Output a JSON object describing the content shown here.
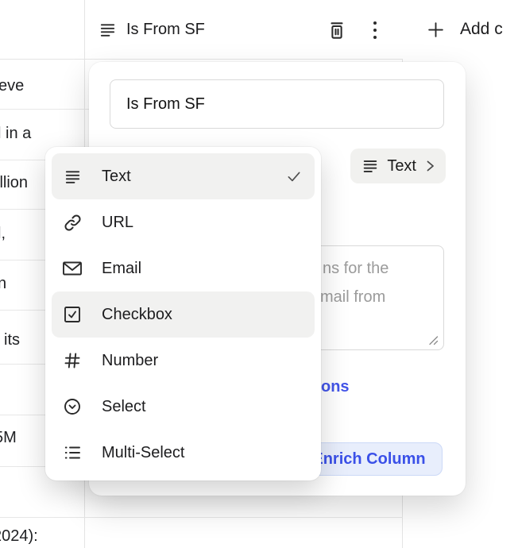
{
  "header": {
    "column_title": "Is From SF",
    "column_type_icon": "text-lines-icon",
    "trash_icon": "trash-icon",
    "kebab_icon": "kebab-menu-icon",
    "add_column_label": "Add c"
  },
  "popup": {
    "name_value": "Is From SF",
    "type_button": {
      "label": "Text",
      "icon": "text-lines-icon",
      "chevron": "chevron-right-icon"
    },
    "description_placeholder_fragments": {
      "line1": "ns for the",
      "line2": "mail from"
    },
    "link_fragment": "ons",
    "enrich_button_label": "Enrich Column"
  },
  "menu": {
    "items": [
      {
        "label": "Text",
        "icon": "text-lines-icon",
        "selected": true,
        "highlighted": true
      },
      {
        "label": "URL",
        "icon": "link-icon",
        "selected": false,
        "highlighted": false
      },
      {
        "label": "Email",
        "icon": "envelope-icon",
        "selected": false,
        "highlighted": false
      },
      {
        "label": "Checkbox",
        "icon": "checkbox-icon",
        "selected": false,
        "highlighted": true
      },
      {
        "label": "Number",
        "icon": "hash-icon",
        "selected": false,
        "highlighted": false
      },
      {
        "label": "Select",
        "icon": "circle-chevron-icon",
        "selected": false,
        "highlighted": false
      },
      {
        "label": "Multi-Select",
        "icon": "multi-list-icon",
        "selected": false,
        "highlighted": false
      }
    ]
  },
  "background": {
    "rows": [
      {
        "text": "eve"
      },
      {
        "text": "l in a"
      },
      {
        "text": "illion"
      },
      {
        "text": "l,"
      },
      {
        "text": "n"
      },
      {
        "text": "l its"
      },
      {
        "text": "5M"
      },
      {
        "text": "2024):"
      }
    ]
  },
  "colors": {
    "accent_blue": "#4355e9",
    "enrich_bg": "#e8eefc",
    "selected_item_bg": "#f1f1f0",
    "divider": "#e4e4e4",
    "placeholder": "#9b9b9b"
  }
}
